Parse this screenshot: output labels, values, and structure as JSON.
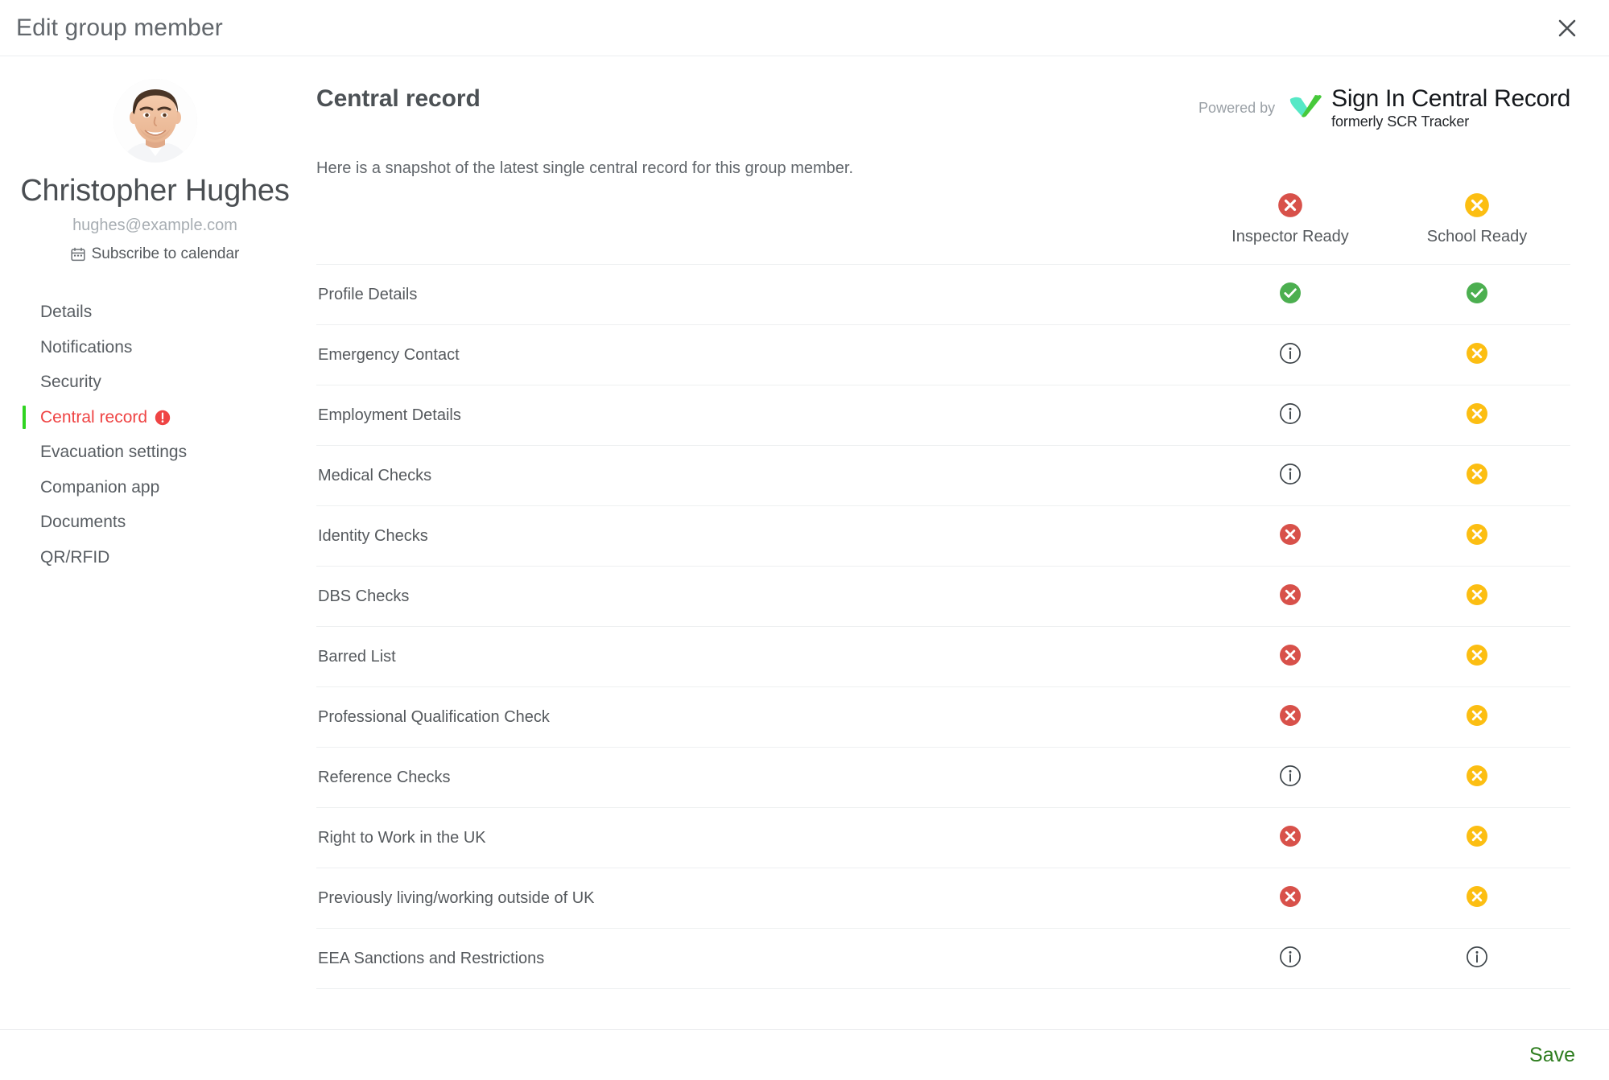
{
  "header": {
    "title": "Edit group member",
    "close_icon": "close-icon"
  },
  "sidebar": {
    "member_name": "Christopher Hughes",
    "member_email": "hughes@example.com",
    "subscribe": {
      "icon": "calendar-icon",
      "label": "Subscribe to calendar"
    },
    "nav_items": [
      {
        "label": "Details",
        "active": false,
        "badge": null
      },
      {
        "label": "Notifications",
        "active": false,
        "badge": null
      },
      {
        "label": "Security",
        "active": false,
        "badge": null
      },
      {
        "label": "Central record",
        "active": true,
        "badge": "alert-icon"
      },
      {
        "label": "Evacuation settings",
        "active": false,
        "badge": null
      },
      {
        "label": "Companion app",
        "active": false,
        "badge": null
      },
      {
        "label": "Documents",
        "active": false,
        "badge": null
      },
      {
        "label": "QR/RFID",
        "active": false,
        "badge": null
      }
    ]
  },
  "main": {
    "title": "Central record",
    "description": "Here is a snapshot of the latest single central record for this group member.",
    "powered_by_label": "Powered by",
    "brand": {
      "mark_icon": "check-mark-logo",
      "name": "Sign In Central Record",
      "tagline": "formerly SCR Tracker"
    },
    "columns": [
      {
        "label": "Inspector Ready",
        "status": "error"
      },
      {
        "label": "School Ready",
        "status": "warning"
      }
    ],
    "rows": [
      {
        "label": "Profile Details",
        "inspector": "success",
        "school": "success"
      },
      {
        "label": "Emergency Contact",
        "inspector": "info",
        "school": "warning"
      },
      {
        "label": "Employment Details",
        "inspector": "info",
        "school": "warning"
      },
      {
        "label": "Medical Checks",
        "inspector": "info",
        "school": "warning"
      },
      {
        "label": "Identity Checks",
        "inspector": "error",
        "school": "warning"
      },
      {
        "label": "DBS Checks",
        "inspector": "error",
        "school": "warning"
      },
      {
        "label": "Barred List",
        "inspector": "error",
        "school": "warning"
      },
      {
        "label": "Professional Qualification Check",
        "inspector": "error",
        "school": "warning"
      },
      {
        "label": "Reference Checks",
        "inspector": "info",
        "school": "warning"
      },
      {
        "label": "Right to Work in the UK",
        "inspector": "error",
        "school": "warning"
      },
      {
        "label": "Previously living/working outside of UK",
        "inspector": "error",
        "school": "warning"
      },
      {
        "label": "EEA Sanctions and Restrictions",
        "inspector": "info",
        "school": "info"
      }
    ]
  },
  "footer": {
    "save_label": "Save"
  },
  "colors": {
    "error": "#d8514a",
    "warning": "#fcbe12",
    "success": "#4caf50",
    "info_outline": "#3d4449",
    "active_nav_text": "#ef4444",
    "active_nav_bar": "#2fd421",
    "save_text": "#2e7d1f",
    "brand_mark_light": "#55e6c1",
    "brand_mark_dark": "#46c93a"
  }
}
